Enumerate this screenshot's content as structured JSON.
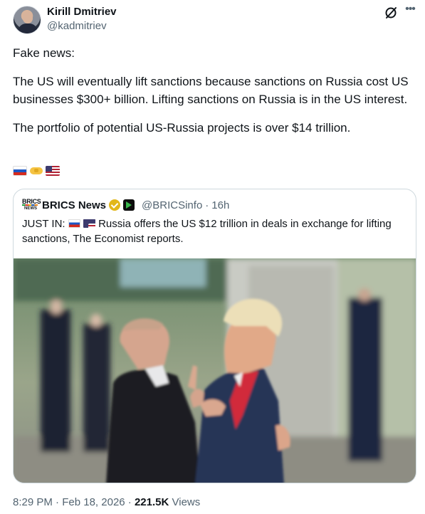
{
  "author": {
    "name": "Kirill Dmitriev",
    "handle": "@kadmitriev"
  },
  "icons": {
    "grok": "grok-icon",
    "more": "more-icon",
    "avatar": "avatar"
  },
  "tweet": {
    "paragraphs": [
      "Fake news:",
      "The US will eventually lift sanctions because sanctions on Russia cost US businesses $300+ billion. Lifting sanctions on Russia is in the US interest.",
      "The portfolio of potential US-Russia projects is over $14 trillion."
    ],
    "emoji": [
      "flag-russia",
      "handshake",
      "flag-united-states"
    ]
  },
  "quoted": {
    "logo_text": "BRICS",
    "logo_subtext": "NEWS",
    "name": "BRICS News",
    "handle": "@BRICSinfo",
    "separator": "·",
    "time": "16h",
    "text_prefix": "JUST IN:",
    "text_body": "Russia offers the US $12 trillion in deals in exchange for lifting sanctions, The Economist reports."
  },
  "footer": {
    "time": "8:29 PM",
    "sep1": "·",
    "date": "Feb 18, 2026",
    "sep2": "·",
    "views_count": "221.5K",
    "views_label": "Views"
  },
  "colors": {
    "text": "#0f1419",
    "secondary": "#536471",
    "border": "#cfd9de",
    "verified_gold": "#e2b719"
  }
}
